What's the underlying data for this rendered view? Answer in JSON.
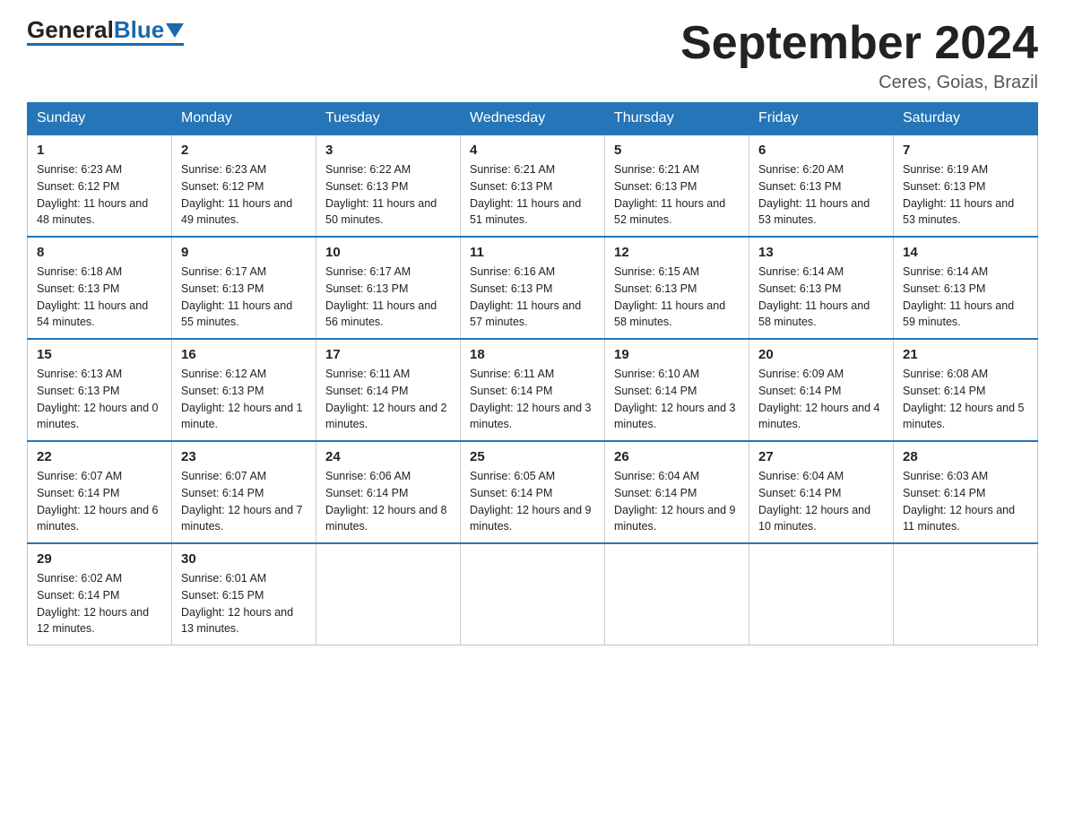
{
  "header": {
    "logo_general": "General",
    "logo_blue": "Blue",
    "title": "September 2024",
    "subtitle": "Ceres, Goias, Brazil"
  },
  "days_of_week": [
    "Sunday",
    "Monday",
    "Tuesday",
    "Wednesday",
    "Thursday",
    "Friday",
    "Saturday"
  ],
  "weeks": [
    [
      {
        "day": "1",
        "sunrise": "6:23 AM",
        "sunset": "6:12 PM",
        "daylight": "11 hours and 48 minutes."
      },
      {
        "day": "2",
        "sunrise": "6:23 AM",
        "sunset": "6:12 PM",
        "daylight": "11 hours and 49 minutes."
      },
      {
        "day": "3",
        "sunrise": "6:22 AM",
        "sunset": "6:13 PM",
        "daylight": "11 hours and 50 minutes."
      },
      {
        "day": "4",
        "sunrise": "6:21 AM",
        "sunset": "6:13 PM",
        "daylight": "11 hours and 51 minutes."
      },
      {
        "day": "5",
        "sunrise": "6:21 AM",
        "sunset": "6:13 PM",
        "daylight": "11 hours and 52 minutes."
      },
      {
        "day": "6",
        "sunrise": "6:20 AM",
        "sunset": "6:13 PM",
        "daylight": "11 hours and 53 minutes."
      },
      {
        "day": "7",
        "sunrise": "6:19 AM",
        "sunset": "6:13 PM",
        "daylight": "11 hours and 53 minutes."
      }
    ],
    [
      {
        "day": "8",
        "sunrise": "6:18 AM",
        "sunset": "6:13 PM",
        "daylight": "11 hours and 54 minutes."
      },
      {
        "day": "9",
        "sunrise": "6:17 AM",
        "sunset": "6:13 PM",
        "daylight": "11 hours and 55 minutes."
      },
      {
        "day": "10",
        "sunrise": "6:17 AM",
        "sunset": "6:13 PM",
        "daylight": "11 hours and 56 minutes."
      },
      {
        "day": "11",
        "sunrise": "6:16 AM",
        "sunset": "6:13 PM",
        "daylight": "11 hours and 57 minutes."
      },
      {
        "day": "12",
        "sunrise": "6:15 AM",
        "sunset": "6:13 PM",
        "daylight": "11 hours and 58 minutes."
      },
      {
        "day": "13",
        "sunrise": "6:14 AM",
        "sunset": "6:13 PM",
        "daylight": "11 hours and 58 minutes."
      },
      {
        "day": "14",
        "sunrise": "6:14 AM",
        "sunset": "6:13 PM",
        "daylight": "11 hours and 59 minutes."
      }
    ],
    [
      {
        "day": "15",
        "sunrise": "6:13 AM",
        "sunset": "6:13 PM",
        "daylight": "12 hours and 0 minutes."
      },
      {
        "day": "16",
        "sunrise": "6:12 AM",
        "sunset": "6:13 PM",
        "daylight": "12 hours and 1 minute."
      },
      {
        "day": "17",
        "sunrise": "6:11 AM",
        "sunset": "6:14 PM",
        "daylight": "12 hours and 2 minutes."
      },
      {
        "day": "18",
        "sunrise": "6:11 AM",
        "sunset": "6:14 PM",
        "daylight": "12 hours and 3 minutes."
      },
      {
        "day": "19",
        "sunrise": "6:10 AM",
        "sunset": "6:14 PM",
        "daylight": "12 hours and 3 minutes."
      },
      {
        "day": "20",
        "sunrise": "6:09 AM",
        "sunset": "6:14 PM",
        "daylight": "12 hours and 4 minutes."
      },
      {
        "day": "21",
        "sunrise": "6:08 AM",
        "sunset": "6:14 PM",
        "daylight": "12 hours and 5 minutes."
      }
    ],
    [
      {
        "day": "22",
        "sunrise": "6:07 AM",
        "sunset": "6:14 PM",
        "daylight": "12 hours and 6 minutes."
      },
      {
        "day": "23",
        "sunrise": "6:07 AM",
        "sunset": "6:14 PM",
        "daylight": "12 hours and 7 minutes."
      },
      {
        "day": "24",
        "sunrise": "6:06 AM",
        "sunset": "6:14 PM",
        "daylight": "12 hours and 8 minutes."
      },
      {
        "day": "25",
        "sunrise": "6:05 AM",
        "sunset": "6:14 PM",
        "daylight": "12 hours and 9 minutes."
      },
      {
        "day": "26",
        "sunrise": "6:04 AM",
        "sunset": "6:14 PM",
        "daylight": "12 hours and 9 minutes."
      },
      {
        "day": "27",
        "sunrise": "6:04 AM",
        "sunset": "6:14 PM",
        "daylight": "12 hours and 10 minutes."
      },
      {
        "day": "28",
        "sunrise": "6:03 AM",
        "sunset": "6:14 PM",
        "daylight": "12 hours and 11 minutes."
      }
    ],
    [
      {
        "day": "29",
        "sunrise": "6:02 AM",
        "sunset": "6:14 PM",
        "daylight": "12 hours and 12 minutes."
      },
      {
        "day": "30",
        "sunrise": "6:01 AM",
        "sunset": "6:15 PM",
        "daylight": "12 hours and 13 minutes."
      },
      null,
      null,
      null,
      null,
      null
    ]
  ]
}
